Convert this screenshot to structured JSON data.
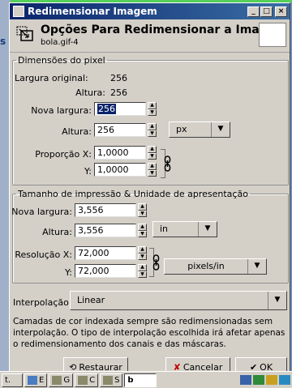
{
  "window": {
    "title": "Redimensionar Imagem"
  },
  "header": {
    "title": "Opções Para Redimensionar a Imagem",
    "subtitle": "bola.gif-4"
  },
  "background": {
    "glyph": "s"
  },
  "pixel_dims": {
    "legend": "Dimensões do pixel",
    "orig_width_label": "Largura original:",
    "orig_width": "256",
    "orig_height_label": "Altura:",
    "orig_height": "256",
    "new_width_label": "Nova largura:",
    "new_width": "256",
    "height_label": "Altura:",
    "height": "256",
    "unit": "px",
    "ratio_x_label": "Proporção X:",
    "ratio_x": "1,0000",
    "ratio_y_label": "Y:",
    "ratio_y": "1,0000"
  },
  "print_size": {
    "legend": "Tamanho de impressão & Unidade de apresentação",
    "new_width_label": "Nova largura:",
    "new_width": "3,556",
    "height_label": "Altura:",
    "height": "3,556",
    "unit": "in",
    "res_x_label": "Resolução X:",
    "res_x": "72,000",
    "res_y_label": "Y:",
    "res_y": "72,000",
    "res_unit": "pixels/in"
  },
  "interpolation": {
    "label": "Interpolação:",
    "value": "Linear"
  },
  "note": "Camadas de cor indexada sempre são redimensionadas sem interpolação. O tipo de interpolação escolhida irá afetar apenas o redimensionamento dos canais e das máscaras.",
  "buttons": {
    "reset": "Restaurar",
    "cancel": "Cancelar",
    "ok": "OK"
  },
  "taskbar": {
    "items": [
      {
        "label": "t.",
        "active": false
      },
      {
        "label": "E",
        "active": false
      },
      {
        "label": "G",
        "active": false
      },
      {
        "label": "C",
        "active": false
      },
      {
        "label": "S",
        "active": false
      },
      {
        "label": "b",
        "active": true
      }
    ]
  },
  "colors": {
    "titlebar": "#0a246a",
    "selection": "#0a246a",
    "face": "#d4d0c8"
  }
}
